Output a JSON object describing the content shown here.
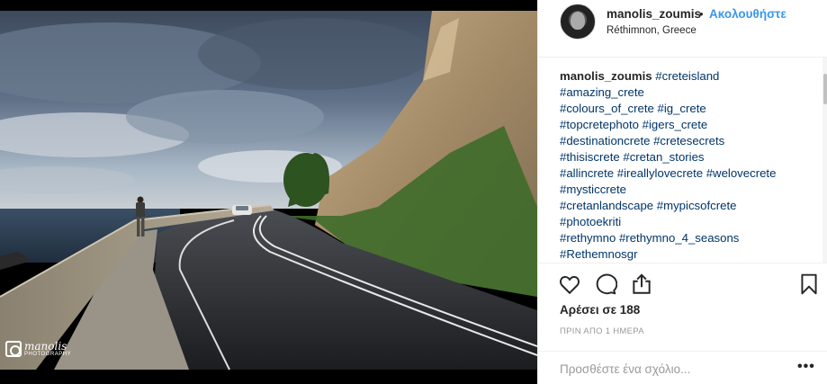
{
  "post": {
    "photo_alt": "Coastal road along sea wall beneath rocky fortress cliff",
    "watermark": {
      "name": "manolis",
      "subtitle": "PHOTOGRAPHY"
    }
  },
  "header": {
    "username": "manolis_zoumis",
    "separator": "•",
    "follow_label": "Ακολουθήστε",
    "location": "Réthimnon, Greece",
    "avatar_icon": "avatar-photo"
  },
  "caption": {
    "username": "manolis_zoumis",
    "lines": [
      "#creteisland",
      "#amazing_crete",
      "#colours_of_crete #ig_crete",
      "#topcretephoto #igers_crete",
      "#destinationcrete #cretesecrets",
      "#thisiscrete #cretan_stories",
      "#allincrete #ireallylovecrete #welovecrete",
      "#mysticcrete",
      "#cretanlandscape #mypicsofcrete",
      "#photoekriti",
      "#rethymno #rethymno_4_seasons",
      "#Rethemnosgr"
    ]
  },
  "actions": {
    "icons": [
      "heart-icon",
      "comment-icon",
      "share-icon",
      "bookmark-icon"
    ],
    "likes": "Αρέσει σε 188",
    "time_ago": "ΠΡΙΝ ΑΠΟ 1 ΗΜΕΡΑ"
  },
  "comment": {
    "placeholder": "Προσθέστε ένα σχόλιο...",
    "more_label": "•••"
  },
  "colors": {
    "follow": "#3897f0",
    "hashtag": "#003569",
    "muted": "#999999",
    "border": "#efefef"
  }
}
